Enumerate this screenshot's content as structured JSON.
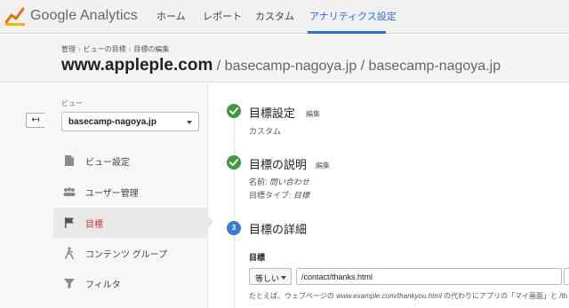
{
  "app": {
    "brand_google": "Google",
    "brand_analytics": "Analytics"
  },
  "nav": {
    "tabs": [
      {
        "label": "ホーム",
        "active": false
      },
      {
        "label": "レポート",
        "active": false
      },
      {
        "label": "カスタム",
        "active": false
      },
      {
        "label": "アナリティクス設定",
        "active": true
      }
    ]
  },
  "breadcrumb": {
    "items": [
      "管理",
      "ビューの目標",
      "目標の編集"
    ],
    "separator": "›"
  },
  "page_title": {
    "account": "www.appleple.com",
    "property": " / basecamp-nagoya.jp",
    "view": " / basecamp-nagoya.jp"
  },
  "sidebar": {
    "view_label": "ビュー",
    "view_selected": "basecamp-nagoya.jp",
    "back_glyph": "↤",
    "items": [
      {
        "label": "ビュー設定",
        "icon": "document-icon",
        "active": false
      },
      {
        "label": "ユーザー管理",
        "icon": "users-icon",
        "active": false
      },
      {
        "label": "目標",
        "icon": "flag-icon",
        "active": true
      },
      {
        "label": "コンテンツ グループ",
        "icon": "person-walk-icon",
        "active": false
      },
      {
        "label": "フィルタ",
        "icon": "filter-icon",
        "active": false
      }
    ]
  },
  "steps": [
    {
      "title": "目標設定",
      "edit": "編集",
      "status": "done",
      "text": "カスタム"
    },
    {
      "title": "目標の説明",
      "edit": "編集",
      "status": "done",
      "name_label": "名前: ",
      "name_value": "問い合わせ",
      "type_label": "目標タイプ: ",
      "type_value": "目標"
    },
    {
      "title": "目標の詳細",
      "number": "3",
      "status": "current"
    }
  ],
  "goal_details": {
    "field_label": "目標",
    "match_type": "等しい",
    "url_value": "/contact/thanks.html",
    "help_prefix": "たとえば、ウェブページの ",
    "help_example": "www.example.com/thankyou.html",
    "help_suffix": " の代わりにアプリの「マイ画面」と /th"
  },
  "colors": {
    "accent": "#2a6fd6",
    "done": "#3c9c3c",
    "current": "#3a7bd5",
    "active_item": "#c0392b"
  }
}
